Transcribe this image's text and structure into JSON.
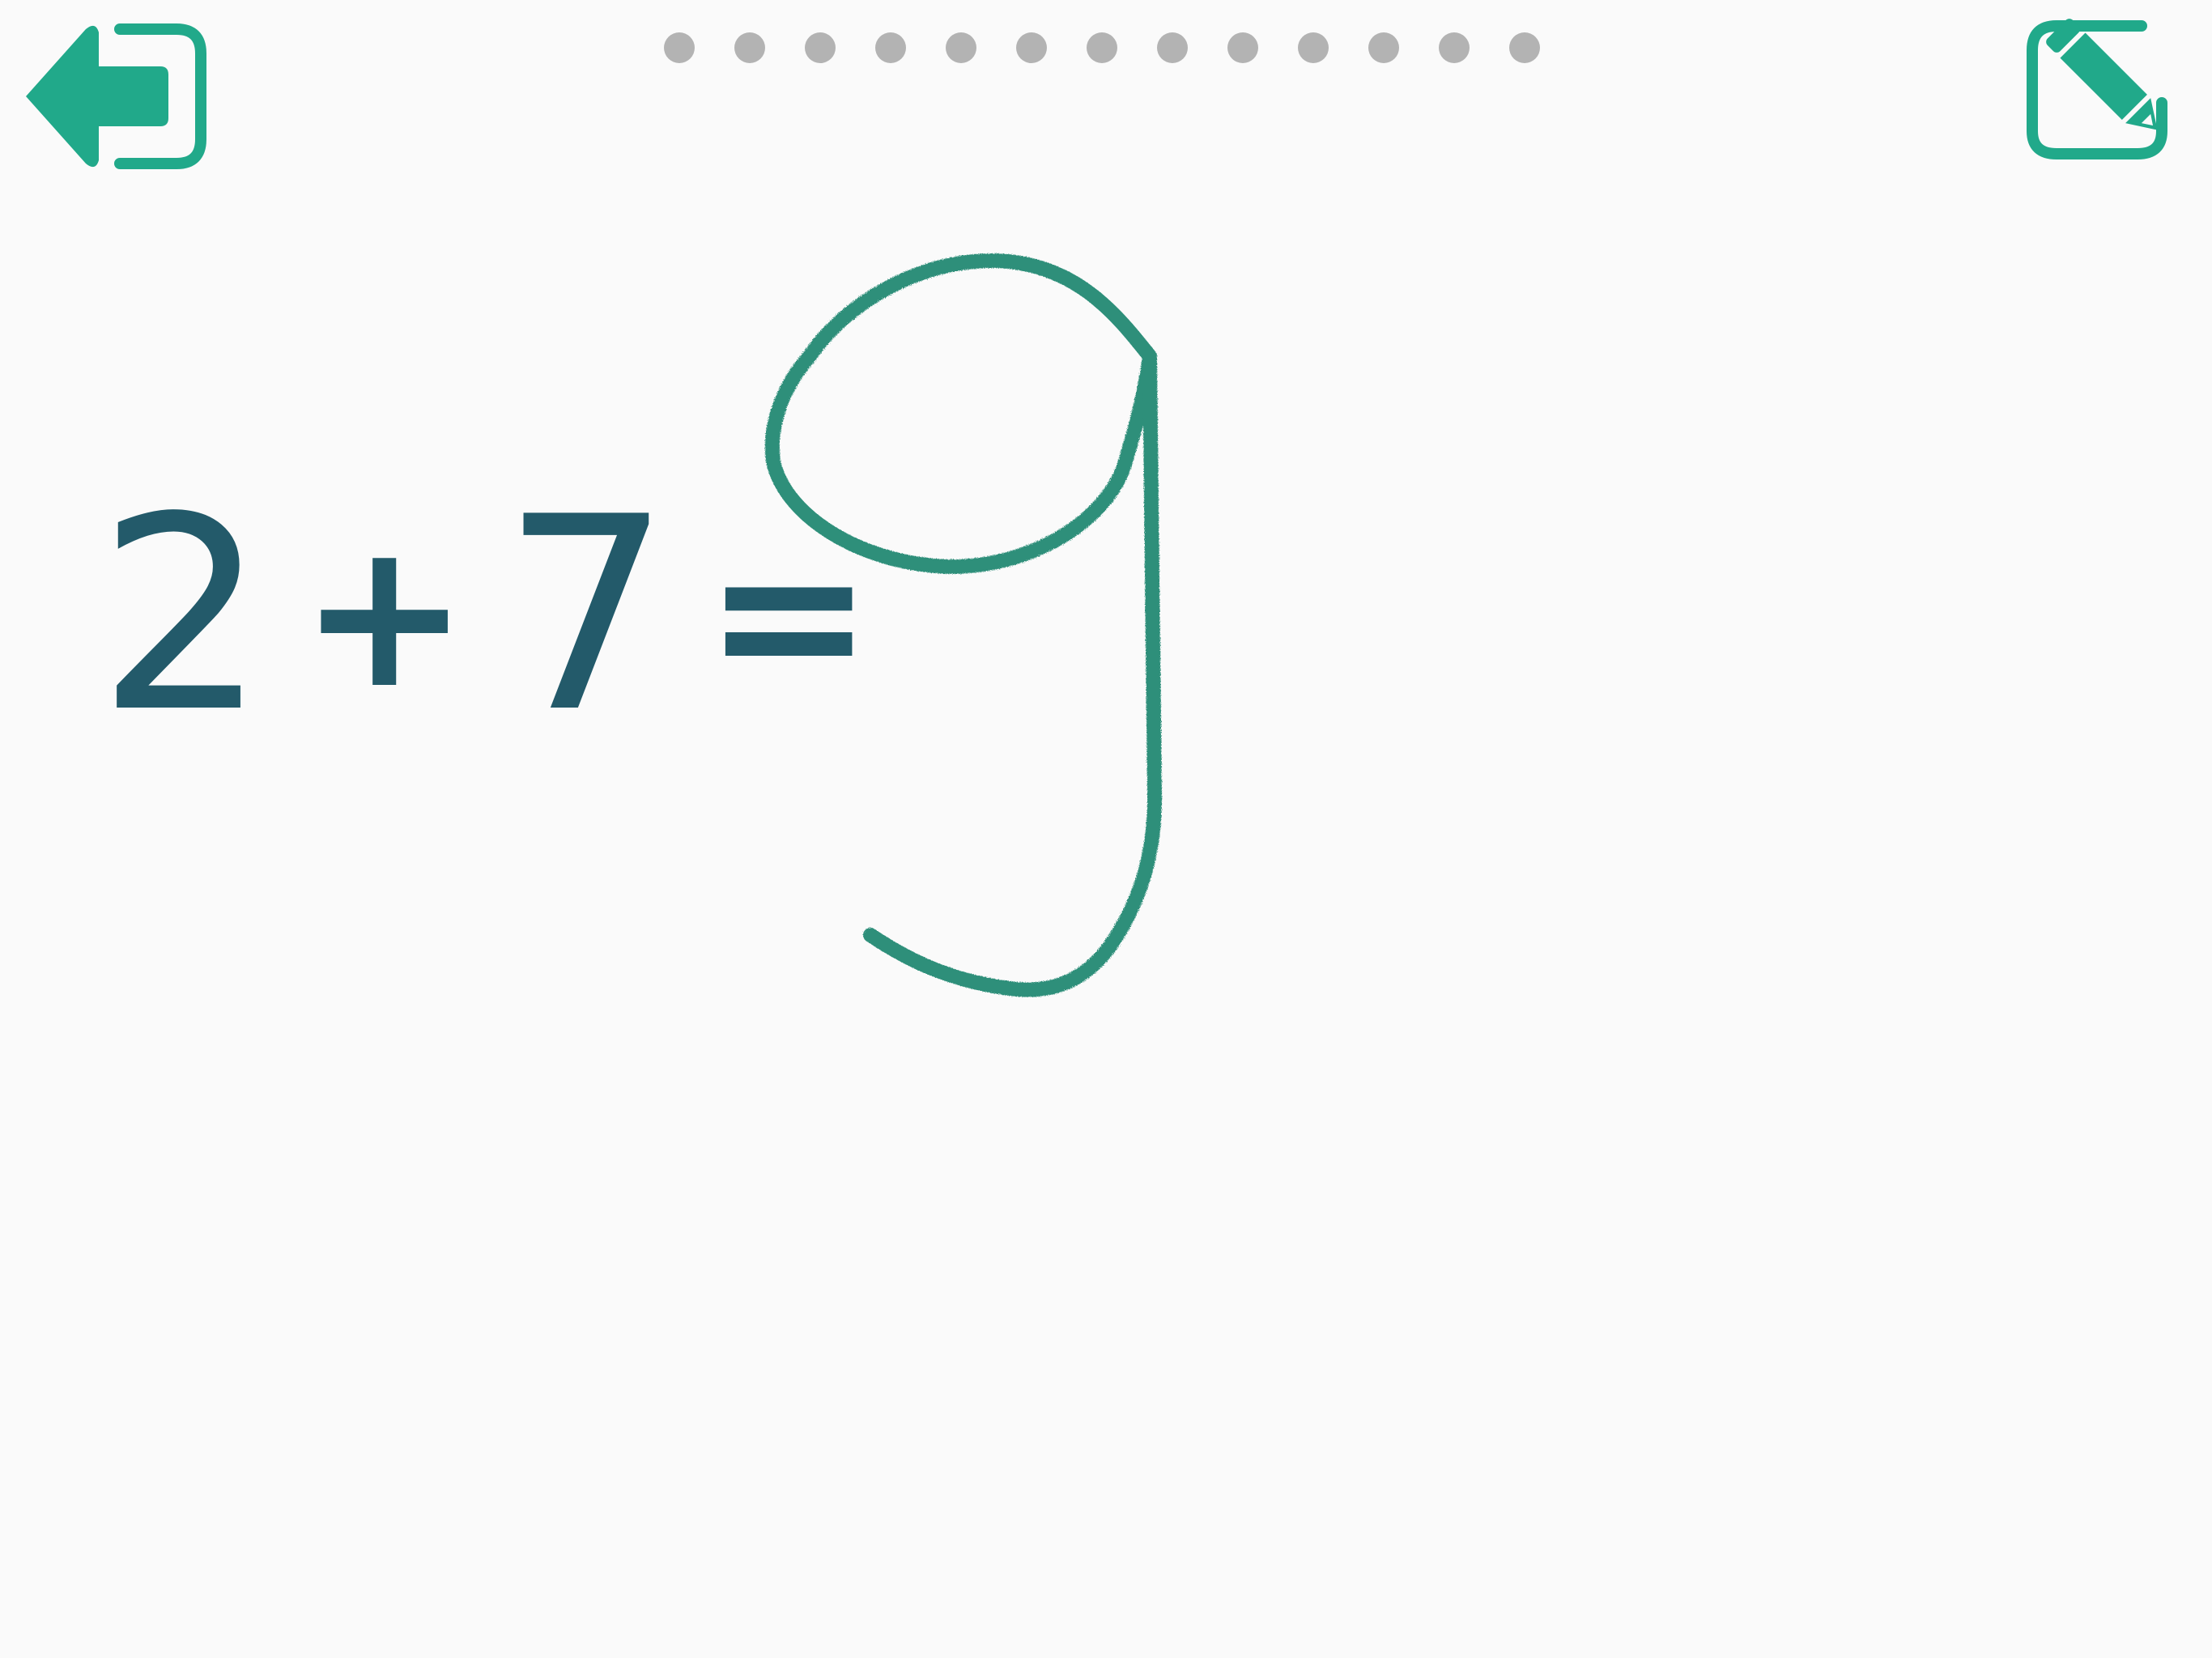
{
  "toolbar": {
    "exit_icon": "exit-arrow-left-icon",
    "edit_icon": "pencil-edit-icon",
    "accent_color": "#21a98a"
  },
  "progress": {
    "total": 13,
    "dot_color": "#b3b3b3"
  },
  "equation": {
    "operand_1": "2",
    "operator": "+",
    "operand_2": "7",
    "equals": "=",
    "text_color": "#235a6a"
  },
  "answer_drawing": {
    "handwritten_value": "9",
    "stroke_color": "#2e8f7a"
  }
}
